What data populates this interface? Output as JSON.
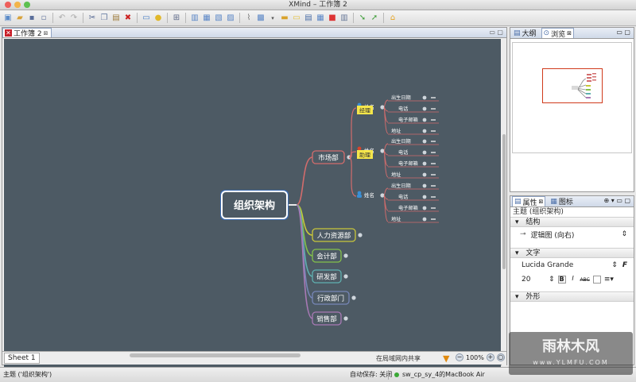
{
  "window": {
    "title": "XMind – 工作簿 2"
  },
  "editor": {
    "tab_label": "工作簿 2",
    "sheet_tab": "Sheet 1",
    "lan_share": "在局域网内共享",
    "zoom": "100%"
  },
  "mindmap": {
    "central": "组织架构",
    "departments": [
      {
        "label": "市场部",
        "color": "#d26c6c"
      },
      {
        "label": "人力资源部",
        "color": "#c9c73a"
      },
      {
        "label": "会计部",
        "color": "#84c14a"
      },
      {
        "label": "研发部",
        "color": "#5fb0b0"
      },
      {
        "label": "行政部门",
        "color": "#7787b8"
      },
      {
        "label": "销售部",
        "color": "#a879b5"
      }
    ],
    "people": [
      {
        "name_label": "姓名",
        "role": "经理",
        "icon_color": "#3a8fd6"
      },
      {
        "name_label": "姓名",
        "role": "助理",
        "icon_color": "#d9452a"
      },
      {
        "name_label": "姓名",
        "role": "",
        "icon_color": "#3a8fd6"
      }
    ],
    "fields": [
      "出生日期",
      "电话",
      "电子邮箱",
      "地址"
    ]
  },
  "panels": {
    "outline_tab": "大纲",
    "overview_tab": "浏览",
    "properties_tab": "属性",
    "icons_tab": "图标",
    "topic_header": "主题 (组织架构)",
    "section_structure": "结构",
    "structure_value": "逻辑图 (向右)",
    "section_text": "文字",
    "font_name": "Lucida Grande",
    "font_size": "20",
    "section_shape": "外形"
  },
  "status": {
    "topic": "主题 ('组织架构')",
    "autosave": "自动保存: 关闭",
    "user": "sw_cp_sy_4的MacBook Air"
  },
  "watermark": {
    "main": "雨林木风",
    "sub": "www.YLMFU.COM"
  },
  "colors": {
    "canvas": "#4d5a64",
    "accent": "#d03a1c"
  }
}
